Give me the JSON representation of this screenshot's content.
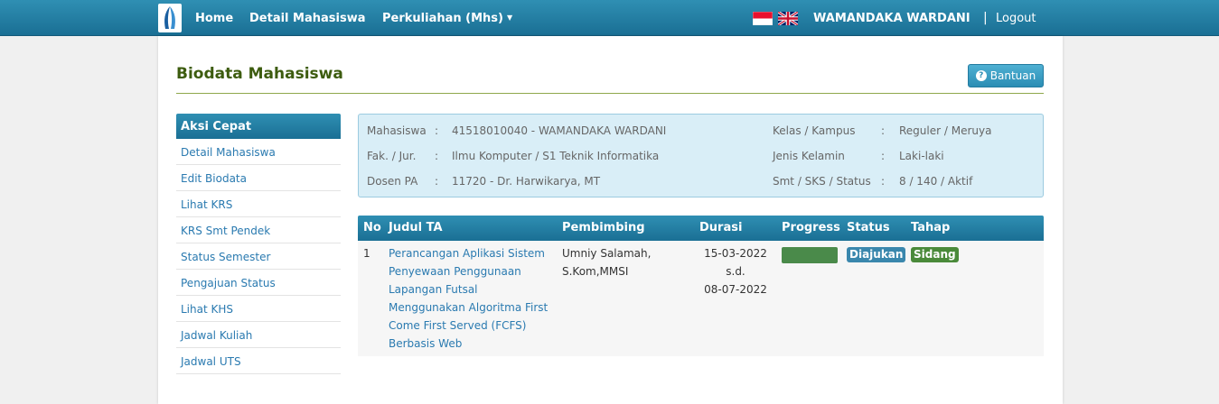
{
  "topbar": {
    "nav": [
      {
        "label": "Home"
      },
      {
        "label": "Detail Mahasiswa"
      },
      {
        "label": "Perkuliahan (Mhs)"
      }
    ],
    "user": "WAMANDAKA WARDANI",
    "separator": "|",
    "logout": "Logout",
    "icons": [
      "logo-icon",
      "indonesia-flag-icon",
      "uk-flag-icon",
      "caret-down-icon"
    ]
  },
  "page": {
    "title": "Biodata Mahasiswa",
    "help_label": "Bantuan",
    "help_icon": "question-circle-icon",
    "title_color": "#3d5c0f",
    "accent": "#1a6f94"
  },
  "sidebar": {
    "title": "Aksi Cepat",
    "items": [
      {
        "label": "Detail Mahasiswa"
      },
      {
        "label": "Edit Biodata"
      },
      {
        "label": "Lihat KRS"
      },
      {
        "label": "KRS Smt Pendek"
      },
      {
        "label": "Status Semester"
      },
      {
        "label": "Pengajuan Status"
      },
      {
        "label": "Lihat KHS"
      },
      {
        "label": "Jadwal Kuliah"
      },
      {
        "label": "Jadwal UTS"
      }
    ]
  },
  "info": {
    "left": [
      {
        "label": "Mahasiswa",
        "colon": ":",
        "value": "41518010040 - WAMANDAKA WARDANI"
      },
      {
        "label": "Fak. / Jur.",
        "colon": ":",
        "value": "Ilmu Komputer / S1 Teknik Informatika"
      },
      {
        "label": "Dosen PA",
        "colon": ":",
        "value": "11720 - Dr. Harwikarya, MT"
      }
    ],
    "right": [
      {
        "label": "Kelas / Kampus",
        "colon": ":",
        "value": "Reguler / Meruya"
      },
      {
        "label": "Jenis Kelamin",
        "colon": ":",
        "value": "Laki-laki"
      },
      {
        "label": "Smt / SKS / Status",
        "colon": ":",
        "value": "8 / 140 / Aktif"
      }
    ]
  },
  "ta_table": {
    "headers": {
      "no": "No",
      "judul": "Judul TA",
      "pembimbing": "Pembimbing",
      "durasi": "Durasi",
      "progress": "Progress",
      "status": "Status",
      "tahap": "Tahap"
    },
    "rows": [
      {
        "no": "1",
        "judul_lines": [
          "Perancangan Aplikasi Sistem",
          "Penyewaan Penggunaan",
          "Lapangan Futsal",
          "Menggunakan Algoritma First",
          "Come First Served (FCFS)",
          "Berbasis Web"
        ],
        "pembimbing_lines": [
          "Umniy Salamah,",
          "S.Kom,MMSI"
        ],
        "durasi_lines": [
          "15-03-2022",
          "s.d.",
          "08-07-2022"
        ],
        "progress": 1.0,
        "progress_color": "#4a8a4a",
        "status": "Diajukan",
        "status_color": "#3a87ad",
        "tahap": "Sidang",
        "tahap_color": "#4a8a3a"
      }
    ]
  }
}
